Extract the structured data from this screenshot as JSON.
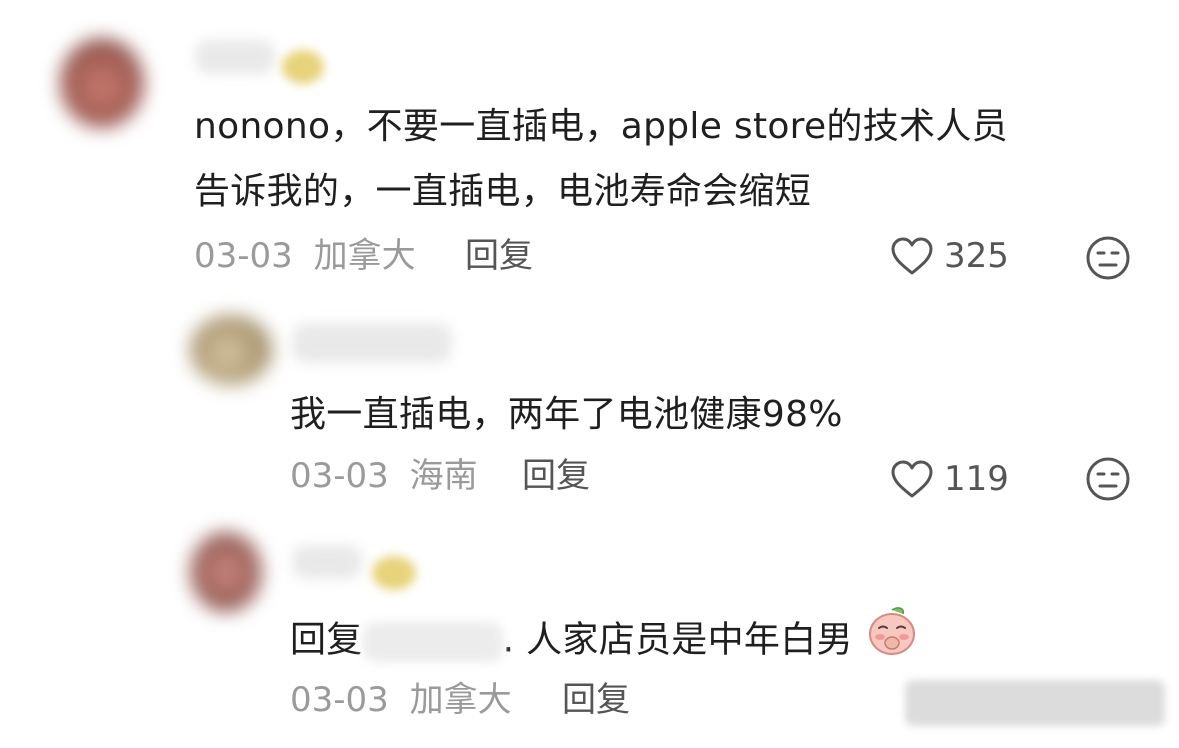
{
  "comments": [
    {
      "text_lines": [
        "nonono，不要一直插电，apple store的技术人员",
        "告诉我的，一直插电，电池寿命会缩短"
      ],
      "date": "03-03",
      "location": "加拿大",
      "reply_label": "回复",
      "likes": "325"
    },
    {
      "text_lines": [
        "我一直插电，两年了电池健康98%"
      ],
      "date": "03-03",
      "location": "海南",
      "reply_label": "回复",
      "likes": "119"
    },
    {
      "text_prefix": "回复",
      "text_suffix": ". 人家店员是中年白男",
      "date": "03-03",
      "location": "加拿大",
      "reply_label": "回复"
    }
  ],
  "icons": {
    "like": "heart-outline-icon",
    "dislike": "neutral-face-icon",
    "emoji": "peach-face-covering-mouth-emoji"
  },
  "colors": {
    "text": "#1f1f1f",
    "meta": "#9a9a9a",
    "action": "#555555"
  }
}
